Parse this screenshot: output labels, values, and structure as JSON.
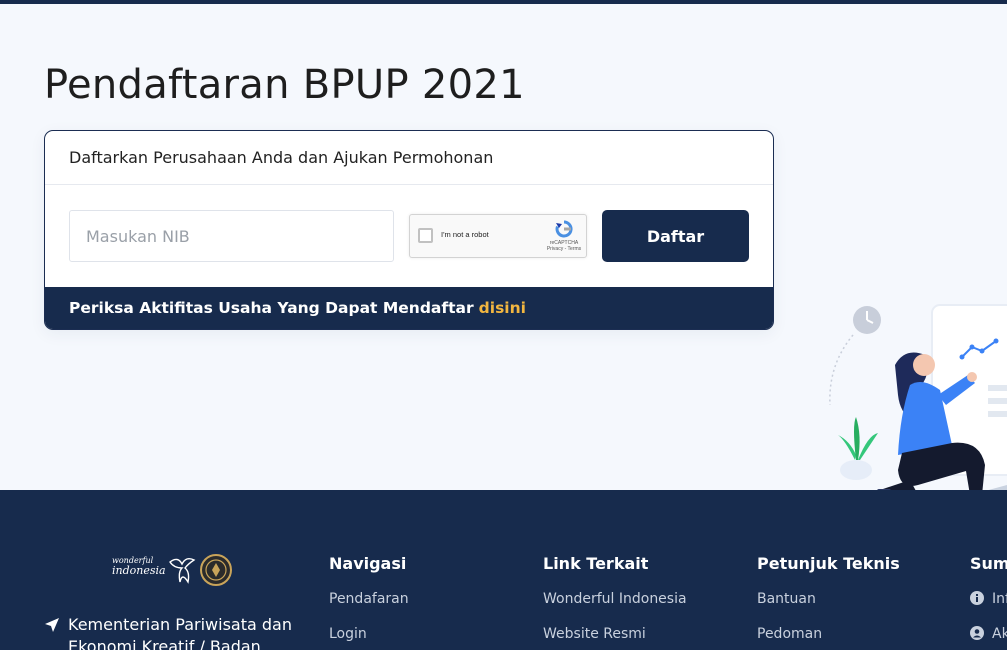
{
  "page": {
    "title": "Pendaftaran BPUP 2021"
  },
  "card": {
    "header": "Daftarkan Perusahaan Anda dan Ajukan Permohonan",
    "nib_placeholder": "Masukan NIB",
    "nib_value": "",
    "recaptcha": {
      "label": "I'm not a robot",
      "brand": "reCAPTCHA",
      "links": "Privacy - Terms"
    },
    "submit_label": "Daftar",
    "footer_text": "Periksa Aktifitas Usaha Yang Dapat Mendaftar",
    "footer_link": "disini"
  },
  "footer": {
    "logo_text_top": "wonderful",
    "logo_text_bottom": "indonesia",
    "address": "Kementerian Pariwisata dan Ekonomi Kreatif / Badan",
    "columns": [
      {
        "title": "Navigasi",
        "links": [
          "Pendafaran",
          "Login"
        ]
      },
      {
        "title": "Link Terkait",
        "links": [
          "Wonderful Indonesia",
          "Website Resmi"
        ]
      },
      {
        "title": "Petunjuk Teknis",
        "links": [
          "Bantuan",
          "Pedoman"
        ]
      },
      {
        "title": "Sumber",
        "links": [
          "Informasi",
          "Akun"
        ],
        "icons": [
          "info-icon",
          "user-circle-icon"
        ]
      }
    ]
  },
  "colors": {
    "navy": "#172b4d",
    "accent": "#f2b640",
    "background": "#f5f8fd"
  }
}
